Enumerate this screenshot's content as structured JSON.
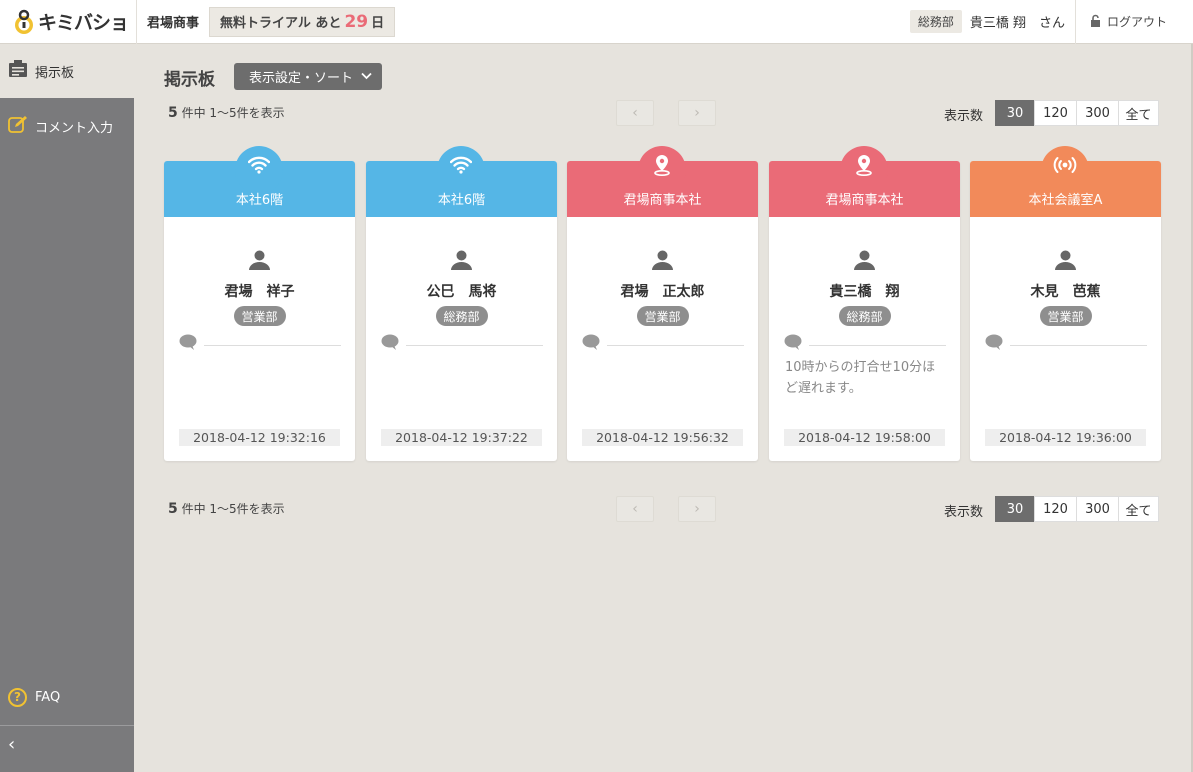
{
  "header": {
    "logo_text": "キミバショ",
    "company": "君場商事",
    "trial_prefix": "無料トライアル あと",
    "trial_days": "29",
    "trial_suffix": "日",
    "user_dept": "総務部",
    "user_name": "貴三橋 翔　さん",
    "logout_label": "ログアウト"
  },
  "sidebar": {
    "board_label": "掲示板",
    "comment_label": "コメント入力",
    "faq_label": "FAQ",
    "collapse_symbol": "‹"
  },
  "main": {
    "title": "掲示板",
    "settings_label": "表示設定・ソート",
    "pager": {
      "total": "5",
      "count_suffix": "件中 1～5件を表示",
      "prev_symbol": "‹",
      "next_symbol": "›",
      "per_page_label": "表示数",
      "per_page_options": [
        "30",
        "120",
        "300",
        "全て"
      ],
      "per_page_selected": "30"
    }
  },
  "colors": {
    "wifi": "#55b6e6",
    "location": "#ea6b77",
    "beacon": "#f28a5a"
  },
  "cards": [
    {
      "type": "wifi",
      "icon": "wifi-icon",
      "location": "本社6階",
      "name": "君場　祥子",
      "dept": "営業部",
      "comment": "",
      "time": "2018-04-12 19:32:16"
    },
    {
      "type": "wifi",
      "icon": "wifi-icon",
      "location": "本社6階",
      "name": "公巳　馬将",
      "dept": "総務部",
      "comment": "",
      "time": "2018-04-12 19:37:22"
    },
    {
      "type": "location",
      "icon": "map-pin-icon",
      "location": "君場商事本社",
      "name": "君場　正太郎",
      "dept": "営業部",
      "comment": "",
      "time": "2018-04-12 19:56:32"
    },
    {
      "type": "location",
      "icon": "map-pin-icon",
      "location": "君場商事本社",
      "name": "貴三橋　翔",
      "dept": "総務部",
      "comment": "10時からの打合せ10分ほど遅れます。",
      "time": "2018-04-12 19:58:00"
    },
    {
      "type": "beacon",
      "icon": "beacon-icon",
      "location": "本社会議室A",
      "name": "木見　芭蕉",
      "dept": "営業部",
      "comment": "",
      "time": "2018-04-12 19:36:00"
    }
  ]
}
